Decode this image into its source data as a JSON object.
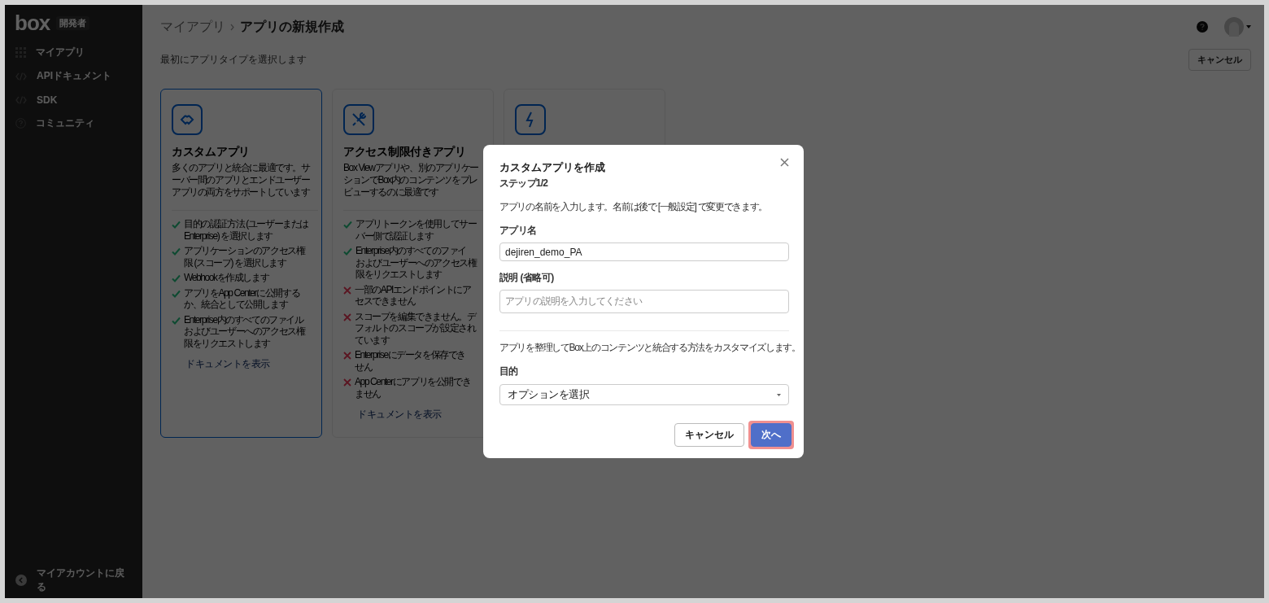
{
  "sidebar": {
    "logo": "box",
    "badge": "開発者",
    "items": [
      {
        "label": "マイアプリ",
        "kind": "grid"
      },
      {
        "label": "APIドキュメント",
        "kind": "code"
      },
      {
        "label": "SDK",
        "kind": "code"
      },
      {
        "label": "コミュニティ",
        "kind": "help"
      }
    ],
    "footer": "マイアカウントに戻る"
  },
  "header": {
    "breadcrumb": [
      "マイアプリ",
      "アプリの新規作成"
    ],
    "subtitle": "最初にアプリタイプを選択します",
    "cancel": "キャンセル"
  },
  "cards": [
    {
      "kind": "link",
      "selected": true,
      "title": "カスタムアプリ",
      "description": [
        "多くのアプリと統合に最適です。サ",
        "ーバー間のアプリとエンドユーザー",
        "アプリの両方をサポートしています"
      ],
      "features": [
        {
          "kind": "check",
          "lines": [
            "目的の認証方法 (ユーザーまたは",
            "Enterprise) を選択します"
          ]
        },
        {
          "kind": "check",
          "lines": [
            "アプリケーションのアクセス権",
            "限 (スコープ) を選択します"
          ]
        },
        {
          "kind": "check",
          "lines": [
            "Webhookを作成します"
          ]
        },
        {
          "kind": "check",
          "lines": [
            "アプリをApp Centerに公開する",
            "か、統合として公開します"
          ]
        },
        {
          "kind": "check",
          "lines": [
            "Enterprise内のすべてのファイル",
            "およびユーザーへのアクセス権",
            "限をリクエストします"
          ]
        }
      ],
      "link": "ドキュメントを表示"
    },
    {
      "kind": "tools",
      "selected": false,
      "title": "アクセス制限付きアプリ",
      "description": [
        "Box Viewアプリや、別のアプリケー",
        "ションでBox内のコンテンツをプレ",
        "ビューするのに最適です"
      ],
      "features": [
        {
          "kind": "check",
          "lines": [
            "アプリトークンを使用してサー",
            "バー側で認証します"
          ]
        },
        {
          "kind": "check",
          "lines": [
            "Enterprise内のすべてのファイ",
            "およびユーザーへのアクセス権",
            "限をリクエストします"
          ]
        },
        {
          "kind": "cross",
          "lines": [
            "一部のAPIエンドポイントにア",
            "セスできません"
          ]
        },
        {
          "kind": "cross",
          "lines": [
            "スコープを編集できません。デ",
            "フォルトのスコープが設定され",
            "ています"
          ]
        },
        {
          "kind": "cross",
          "lines": [
            "Enterpriseにデータを保存でき",
            "せん"
          ]
        },
        {
          "kind": "cross",
          "lines": [
            "App Centerにアプリを公開でき",
            "ません"
          ]
        }
      ],
      "link": "ドキュメントを表示"
    },
    {
      "kind": "bolt",
      "selected": false
    }
  ],
  "modal": {
    "title": "カスタムアプリを作成",
    "step": "ステップ1/2",
    "intro": "アプリの名前を入力します。名前は後で [一般設定] で変更できます。",
    "name_label": "アプリ名",
    "name_value": "dejiren_demo_PA",
    "description_label": "説明 (省略可)",
    "description_placeholder": "アプリの説明を入力してください",
    "customize_text": "アプリを整理してBox上のコンテンツと統合する方法をカスタマイズします。",
    "purpose_label": "目的",
    "purpose_value": "オプションを選択",
    "buttons": [
      {
        "label": "キャンセル",
        "kind": "secondary",
        "highlighted": false
      },
      {
        "label": "次へ",
        "kind": "primary",
        "highlighted": true
      }
    ]
  }
}
